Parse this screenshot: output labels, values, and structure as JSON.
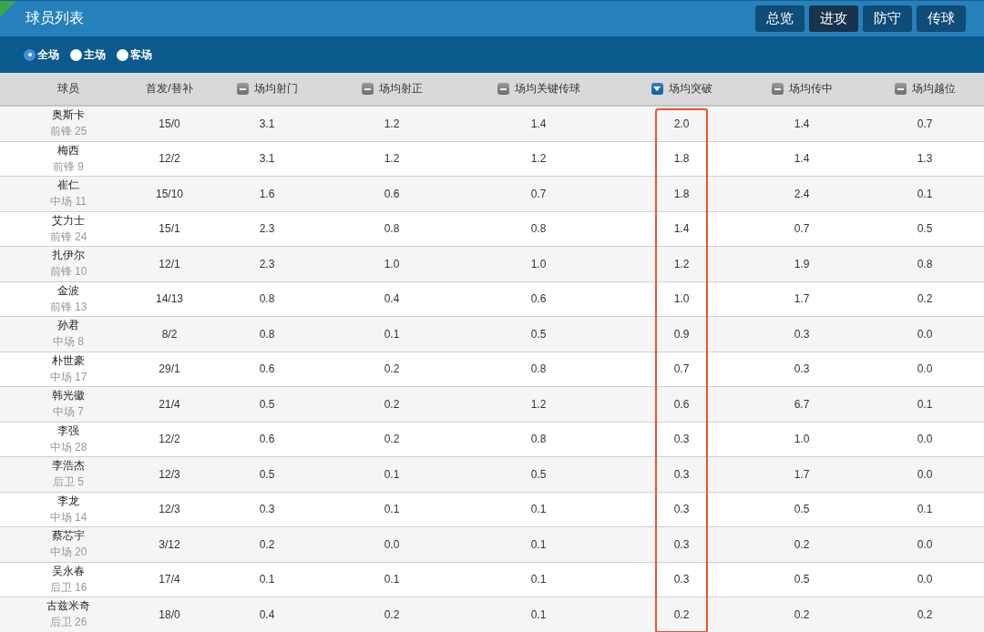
{
  "title": "球员列表",
  "view_buttons": [
    {
      "label": "总览",
      "selected": false
    },
    {
      "label": "进攻",
      "selected": true
    },
    {
      "label": "防守",
      "selected": false
    },
    {
      "label": "传球",
      "selected": false
    }
  ],
  "venue_filter": [
    {
      "label": "全场",
      "selected": true
    },
    {
      "label": "主场",
      "selected": false
    },
    {
      "label": "客场",
      "selected": false
    }
  ],
  "table": {
    "columns": [
      {
        "label": "球员"
      },
      {
        "label": "首发/替补"
      },
      {
        "label": "场均射门",
        "sorted": false
      },
      {
        "label": "场均射正",
        "sorted": false
      },
      {
        "label": "场均关键传球",
        "sorted": false
      },
      {
        "label": "场均突破",
        "sorted": true,
        "highlighted": true
      },
      {
        "label": "场均传中",
        "sorted": false
      },
      {
        "label": "场均越位",
        "sorted": false
      }
    ],
    "rows": [
      {
        "cells": [
          {
            "name": "奥斯卡",
            "position": "前锋 25"
          },
          "15/0",
          "3.1",
          "1.2",
          "1.4",
          "2.0",
          "1.4",
          "0.7"
        ]
      },
      {
        "cells": [
          {
            "name": "梅西",
            "position": "前锋 9"
          },
          "12/2",
          "3.1",
          "1.2",
          "1.2",
          "1.8",
          "1.4",
          "1.3"
        ]
      },
      {
        "cells": [
          {
            "name": "崔仁",
            "position": "中场 11"
          },
          "15/10",
          "1.6",
          "0.6",
          "0.7",
          "1.8",
          "2.4",
          "0.1"
        ]
      },
      {
        "cells": [
          {
            "name": "艾力士",
            "position": "前锋 24"
          },
          "15/1",
          "2.3",
          "0.8",
          "0.8",
          "1.4",
          "0.7",
          "0.5"
        ]
      },
      {
        "cells": [
          {
            "name": "扎伊尔",
            "position": "前锋 10"
          },
          "12/1",
          "2.3",
          "1.0",
          "1.0",
          "1.2",
          "1.9",
          "0.8"
        ]
      },
      {
        "cells": [
          {
            "name": "金波",
            "position": "前锋 13"
          },
          "14/13",
          "0.8",
          "0.4",
          "0.6",
          "1.0",
          "1.7",
          "0.2"
        ]
      },
      {
        "cells": [
          {
            "name": "孙君",
            "position": "中场 8"
          },
          "8/2",
          "0.8",
          "0.1",
          "0.5",
          "0.9",
          "0.3",
          "0.0"
        ]
      },
      {
        "cells": [
          {
            "name": "朴世豪",
            "position": "中场 17"
          },
          "29/1",
          "0.6",
          "0.2",
          "0.8",
          "0.7",
          "0.3",
          "0.0"
        ]
      },
      {
        "cells": [
          {
            "name": "韩光徽",
            "position": "中场 7"
          },
          "21/4",
          "0.5",
          "0.2",
          "1.2",
          "0.6",
          "6.7",
          "0.1"
        ]
      },
      {
        "cells": [
          {
            "name": "李强",
            "position": "中场 28"
          },
          "12/2",
          "0.6",
          "0.2",
          "0.8",
          "0.3",
          "1.0",
          "0.0"
        ]
      },
      {
        "cells": [
          {
            "name": "李浩杰",
            "position": "后卫 5"
          },
          "12/3",
          "0.5",
          "0.1",
          "0.5",
          "0.3",
          "1.7",
          "0.0"
        ]
      },
      {
        "cells": [
          {
            "name": "李龙",
            "position": "中场 14"
          },
          "12/3",
          "0.3",
          "0.1",
          "0.1",
          "0.3",
          "0.5",
          "0.1"
        ]
      },
      {
        "cells": [
          {
            "name": "蔡芯宇",
            "position": "中场 20"
          },
          "3/12",
          "0.2",
          "0.0",
          "0.1",
          "0.3",
          "0.2",
          "0.0"
        ]
      },
      {
        "cells": [
          {
            "name": "吴永春",
            "position": "后卫 16"
          },
          "17/4",
          "0.1",
          "0.1",
          "0.1",
          "0.3",
          "0.5",
          "0.0"
        ]
      },
      {
        "cells": [
          {
            "name": "古兹米奇",
            "position": "后卫 26"
          },
          "18/0",
          "0.4",
          "0.2",
          "0.1",
          "0.2",
          "0.2",
          "0.2"
        ]
      }
    ]
  }
}
